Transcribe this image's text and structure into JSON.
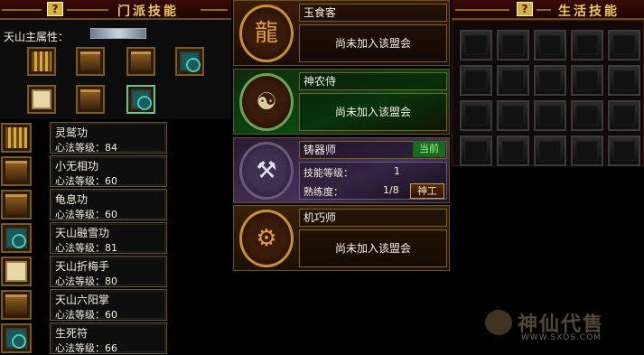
{
  "sect_header": {
    "button": "?",
    "title": "门派技能"
  },
  "life_header": {
    "button": "?",
    "title": "生活技能"
  },
  "main_attr_label": "天山主属性：",
  "skill_grid": [
    {
      "icon": "gold-book-icon"
    },
    {
      "icon": "brown-book-icon"
    },
    {
      "icon": "brown-book-icon"
    },
    {
      "icon": "teal-book-icon"
    },
    {
      "icon": "cream-book-icon"
    },
    {
      "icon": "brown-book-icon"
    },
    {
      "icon": "teal-book-icon"
    }
  ],
  "skills": [
    {
      "name": "灵鹫功",
      "level": "心法等级：84",
      "icon": "gold-book-icon"
    },
    {
      "name": "小无相功",
      "level": "心法等级：60",
      "icon": "brown-book-icon"
    },
    {
      "name": "龟息功",
      "level": "心法等级：60",
      "icon": "brown-book-icon"
    },
    {
      "name": "天山融雪功",
      "level": "心法等级：81",
      "icon": "teal-book-icon"
    },
    {
      "name": "天山折梅手",
      "level": "心法等级：80",
      "icon": "cream-book-icon"
    },
    {
      "name": "天山六阳掌",
      "level": "心法等级：60",
      "icon": "brown-book-icon"
    },
    {
      "name": "生死符",
      "level": "心法等级：66",
      "icon": "teal-book-icon"
    }
  ],
  "alliances": {
    "yushike": {
      "name": "玉食客",
      "status": "尚未加入该盟会",
      "icon": "dragon-emblem-icon"
    },
    "shennong": {
      "name": "神农侍",
      "status": "尚未加入该盟会",
      "icon": "yin-yang-emblem-icon"
    },
    "zhuqi": {
      "name": "铸器师",
      "current": "当前",
      "skill_level_label": "技能等级：",
      "skill_level_value": "1",
      "proficiency_label": "熟练度：",
      "proficiency_value": "1/8",
      "work_button": "神工",
      "icon": "anvil-emblem-icon"
    },
    "jiqiao": {
      "name": "机巧师",
      "status": "尚未加入该盟会",
      "icon": "gear-emblem-icon"
    }
  },
  "life_skill_slots": 20,
  "watermark": {
    "text": "神仙代售",
    "url": "WWW.SXDS.COM"
  },
  "colors": {
    "gold_text": "#f0c860",
    "panel_border": "#7a5a20",
    "current_green": "#1a6a20"
  }
}
